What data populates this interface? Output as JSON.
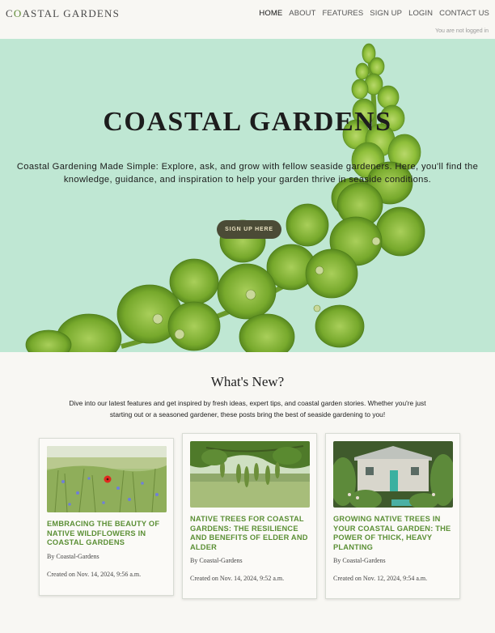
{
  "nav": {
    "logo_first": "C",
    "logo_o": "O",
    "logo_rest": "ASTAL GARDENS",
    "items": [
      "HOME",
      "ABOUT",
      "FEATURES",
      "SIGN UP",
      "LOGIN",
      "CONTACT US"
    ],
    "login_status": "You are not logged in"
  },
  "hero": {
    "title": "COASTAL GARDENS",
    "text": "Coastal Gardening Made Simple: Explore, ask, and grow with fellow seaside gardeners. Here, you'll find the knowledge, guidance, and inspiration to help your garden thrive in seaside conditions.",
    "button": "SIGN UP HERE"
  },
  "whats_new": {
    "title": "What's New?",
    "description": "Dive into our latest features and get inspired by fresh ideas, expert tips, and coastal garden stories. Whether you're just starting out or a seasoned gardener, these posts bring the best of seaside gardening to you!"
  },
  "posts": [
    {
      "title": "EMBRACING THE BEAUTY OF NATIVE WILDFLOWERS IN COASTAL GARDENS",
      "author": "By Coastal-Gardens",
      "created": "Created on Nov. 14, 2024, 9:56 a.m.",
      "image": "wildflower-meadow"
    },
    {
      "title": "NATIVE TREES FOR COASTAL GARDENS: THE RESILIENCE AND BENEFITS OF ELDER AND ALDER",
      "author": "By Coastal-Gardens",
      "created": "Created on Nov. 14, 2024, 9:52 a.m.",
      "image": "alder-catkins"
    },
    {
      "title": "GROWING NATIVE TREES IN YOUR COASTAL GARDEN: THE POWER OF THICK, HEAVY PLANTING",
      "author": "By Coastal-Gardens",
      "created": "Created on Nov. 12, 2024, 9:54 a.m.",
      "image": "cottage-garden"
    }
  ],
  "colors": {
    "hero_bg": "#bfe7d3",
    "accent_green": "#5b8f35",
    "button_bg": "#4b4b36",
    "page_bg": "#f8f7f3"
  }
}
